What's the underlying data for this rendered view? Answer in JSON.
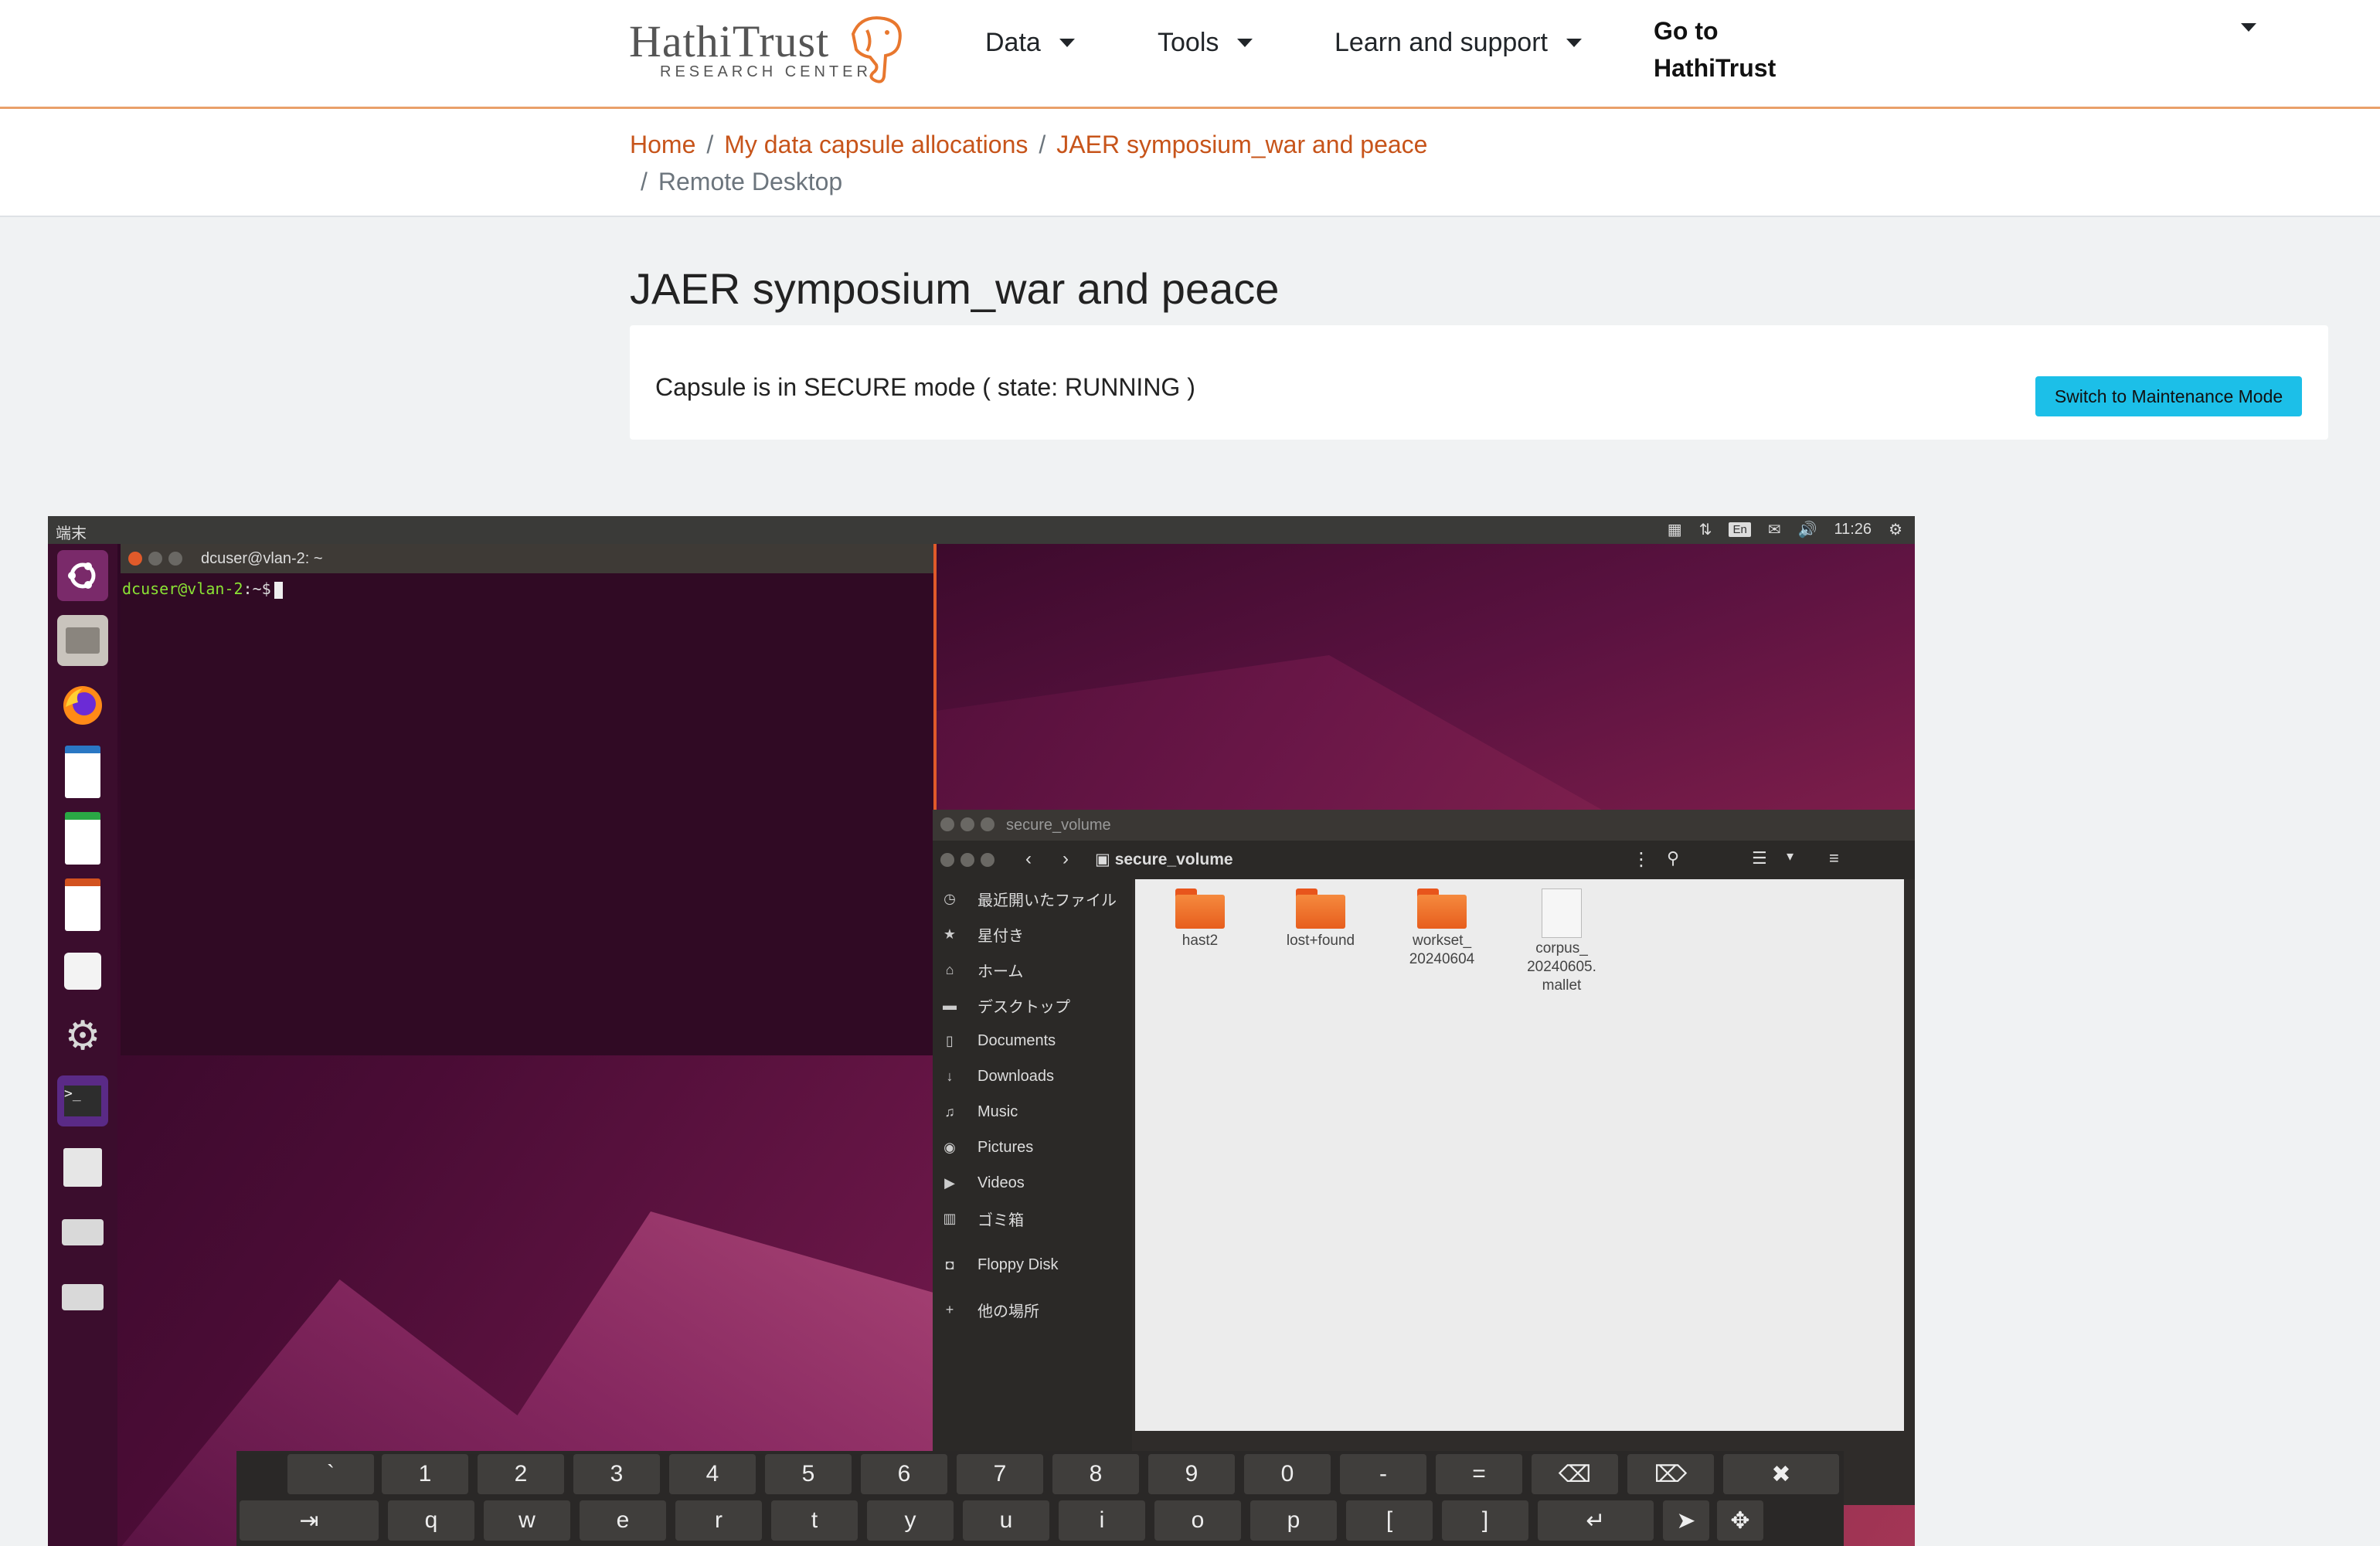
{
  "nav": {
    "logo_word": "HathiTrust",
    "logo_sub": "RESEARCH CENTER",
    "items": [
      {
        "label": "Data"
      },
      {
        "label": "Tools"
      },
      {
        "label": "Learn and support"
      }
    ],
    "goto_line1": "Go to",
    "goto_line2": "HathiTrust"
  },
  "breadcrumb": [
    {
      "label": "Home"
    },
    {
      "label": "My data capsule allocations"
    },
    {
      "label": "JAER symposium_war and peace"
    },
    {
      "label": "Remote Desktop"
    }
  ],
  "page": {
    "title": "JAER symposium_war and peace",
    "status": "Capsule is in SECURE mode ( state: RUNNING )",
    "maintenance_button": "Switch to Maintenance Mode"
  },
  "desktop": {
    "topbar_left": "端末",
    "topbar_lang": "En",
    "clock": "11:26",
    "terminal": {
      "title": "dcuser@vlan-2: ~",
      "prompt_user": "dcuser@vlan-2",
      "prompt_path": ":~$"
    },
    "files": {
      "window_title": "secure_volume",
      "path": "secure_volume",
      "sidebar": [
        {
          "label": "最近開いたファイル",
          "icon": "clock-icon"
        },
        {
          "label": "星付き",
          "icon": "star-icon"
        },
        {
          "label": "ホーム",
          "icon": "home-icon"
        },
        {
          "label": "デスクトップ",
          "icon": "folder-icon"
        },
        {
          "label": "Documents",
          "icon": "document-icon"
        },
        {
          "label": "Downloads",
          "icon": "download-icon"
        },
        {
          "label": "Music",
          "icon": "music-icon"
        },
        {
          "label": "Pictures",
          "icon": "camera-icon"
        },
        {
          "label": "Videos",
          "icon": "video-icon"
        },
        {
          "label": "ゴミ箱",
          "icon": "trash-icon"
        },
        {
          "label": "Floppy Disk",
          "icon": "floppy-icon"
        },
        {
          "label": "他の場所",
          "icon": "plus-icon"
        }
      ],
      "items": [
        {
          "line1": "hast2",
          "line2": "",
          "line3": "",
          "type": "folder"
        },
        {
          "line1": "lost+found",
          "line2": "",
          "line3": "",
          "type": "folder"
        },
        {
          "line1": "workset_",
          "line2": "20240604",
          "line3": "",
          "type": "folder"
        },
        {
          "line1": "corpus_",
          "line2": "20240605.",
          "line3": "mallet",
          "type": "file"
        }
      ]
    },
    "keyboard": {
      "row1": [
        "`",
        "1",
        "2",
        "3",
        "4",
        "5",
        "6",
        "7",
        "8",
        "9",
        "0",
        "-",
        "="
      ],
      "row2": [
        "q",
        "w",
        "e",
        "r",
        "t",
        "y",
        "u",
        "i",
        "o",
        "p",
        "[",
        "]"
      ]
    }
  }
}
